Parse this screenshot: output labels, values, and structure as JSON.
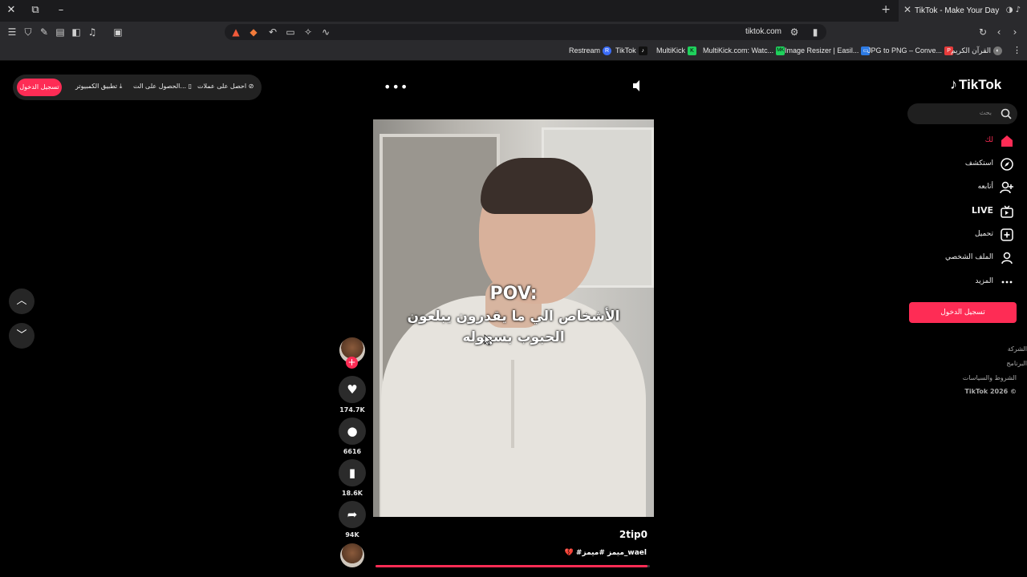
{
  "browser": {
    "tab_title": "TikTok - Make Your Day",
    "url": "tiktok.com",
    "bookmarks": [
      {
        "label": "Restream",
        "fav": "R",
        "color": "#3b6cf6"
      },
      {
        "label": "TikTok",
        "fav": "♪",
        "color": "#111111"
      },
      {
        "label": "MultiKick",
        "fav": "K",
        "color": "#1fd15c"
      },
      {
        "label": "MultiKick.com: Watc...",
        "fav": "MK",
        "color": "#1fd15c"
      },
      {
        "label": "Image Resizer | Easil...",
        "fav": "▭",
        "color": "#2d7be5"
      },
      {
        "label": "JPG to PNG – Conve...",
        "fav": "P",
        "color": "#e63b3b"
      },
      {
        "label": "القرآن الكريم",
        "fav": "◐",
        "color": "#777777"
      }
    ]
  },
  "topbar": {
    "login_label": "تسجيل الدخول",
    "desktop_app_label": "تطبيق الكمبيوتر",
    "get_app_label": "الحصول على الت...",
    "coins_label": "احصل على عملات"
  },
  "video": {
    "overlay_title": "POV:",
    "overlay_text": "الأشخاص الي ما يقدرون يبلعون الحبوب بسهوله",
    "username": "2tip0",
    "hashtags": "💔 #ميمز #ميمز_wael",
    "progress_fraction": 0.99
  },
  "actions": {
    "likes": "174.7K",
    "comments": "6616",
    "saves": "18.6K",
    "shares": "94K"
  },
  "sidebar": {
    "logo": "TikTok",
    "search_placeholder": "بحث",
    "nav": [
      {
        "label": "لك",
        "icon": "home-icon",
        "active": true
      },
      {
        "label": "استكشف",
        "icon": "compass-icon",
        "active": false
      },
      {
        "label": "أتابعه",
        "icon": "following-icon",
        "active": false
      },
      {
        "label": "LIVE",
        "icon": "live-icon",
        "active": false
      },
      {
        "label": "تحميل",
        "icon": "upload-icon",
        "active": false
      },
      {
        "label": "الملف الشخصي",
        "icon": "profile-icon",
        "active": false
      },
      {
        "label": "المزيد",
        "icon": "more-icon",
        "active": false
      }
    ],
    "login_button": "تسجيل الدخول",
    "footer": [
      "الشركة",
      "البرنامج",
      "الشروط والسياسات"
    ],
    "copyright": "TikTok 2026 ©"
  },
  "colors": {
    "accent": "#fe2c55",
    "background": "#000000"
  }
}
